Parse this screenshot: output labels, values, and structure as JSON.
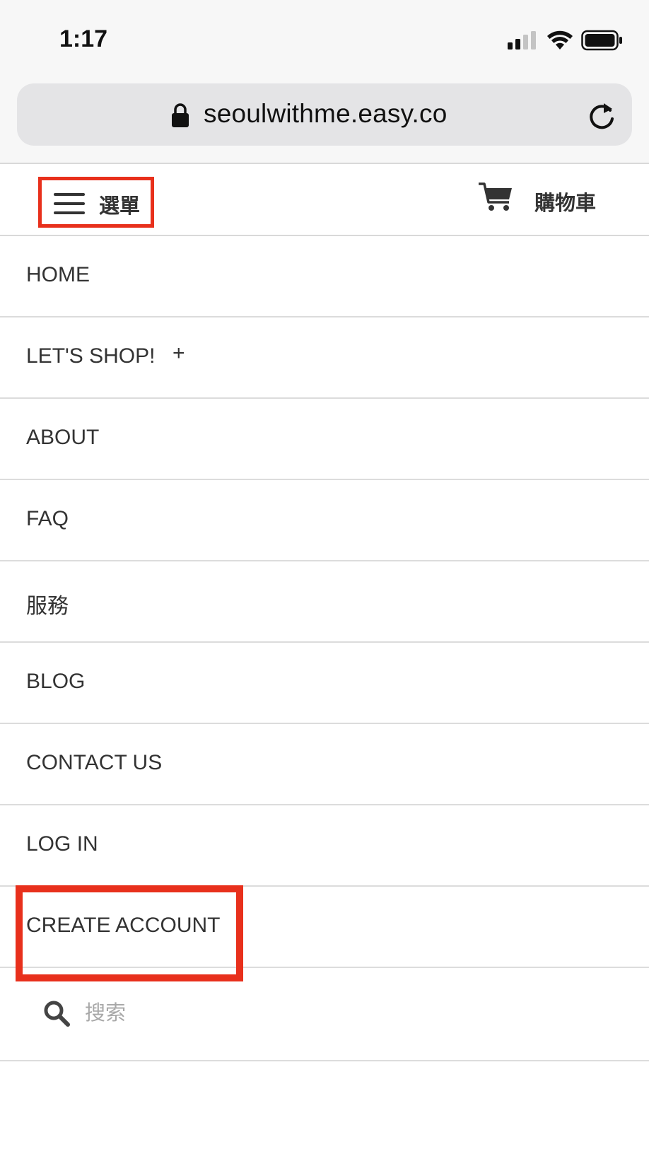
{
  "status_bar": {
    "time": "1:17",
    "icons": [
      "signal-icon",
      "wifi-icon",
      "battery-icon"
    ]
  },
  "browser": {
    "url": "seoulwithme.easy.co",
    "icons": [
      "lock-icon",
      "reload-icon"
    ]
  },
  "header": {
    "menu_label": "選單",
    "cart_label": "購物車",
    "highlight_color": "#e8301c"
  },
  "nav": {
    "items": [
      {
        "label": "HOME"
      },
      {
        "label": "LET'S SHOP!",
        "expand": "+"
      },
      {
        "label": "ABOUT"
      },
      {
        "label": "FAQ"
      },
      {
        "label": "服務"
      },
      {
        "label": "BLOG"
      },
      {
        "label": "CONTACT US"
      },
      {
        "label": "LOG IN"
      },
      {
        "label": "CREATE ACCOUNT"
      }
    ]
  },
  "search": {
    "placeholder": "搜索",
    "value": ""
  }
}
